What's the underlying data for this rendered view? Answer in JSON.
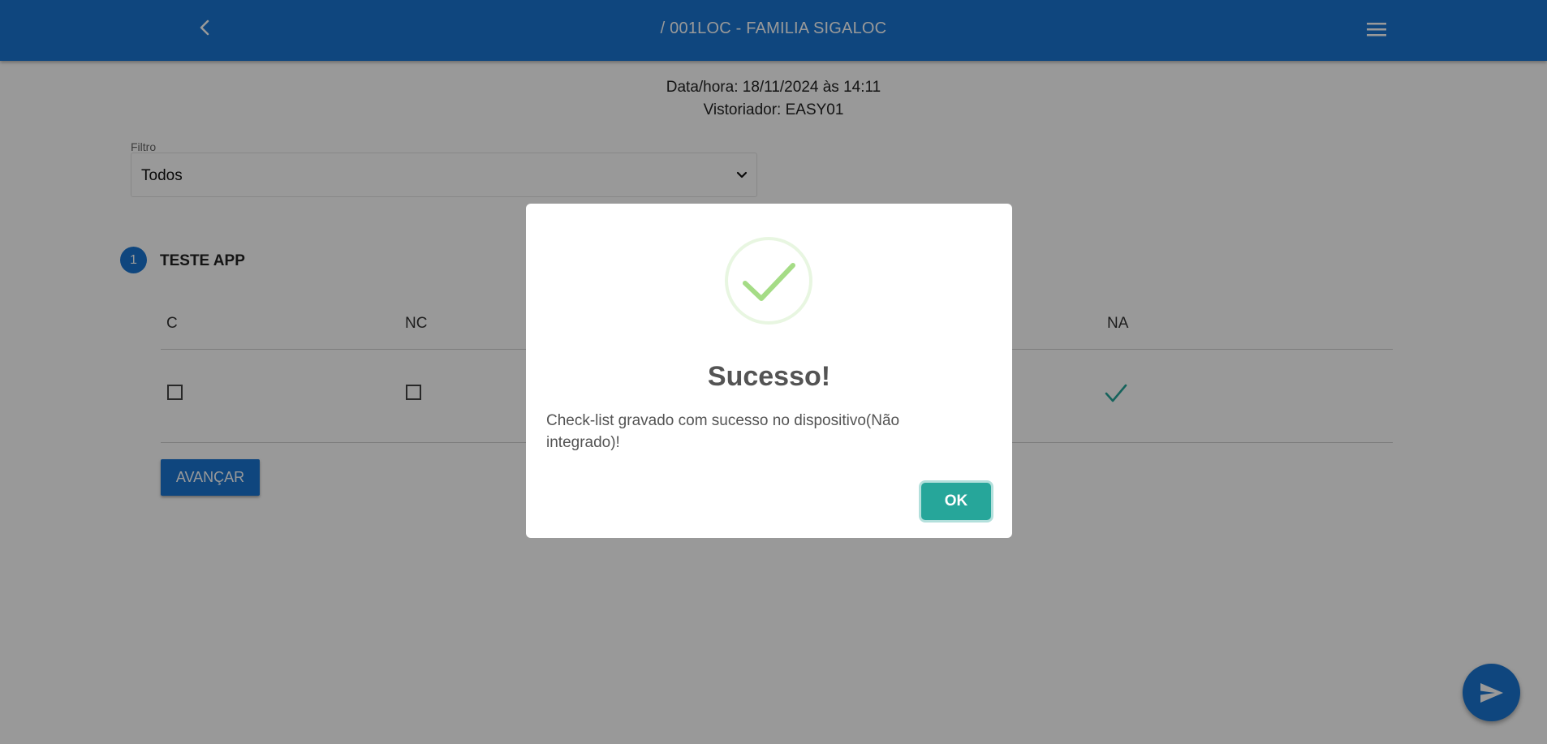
{
  "header": {
    "title": "/ 001LOC - FAMILIA SIGALOC",
    "back_icon": "chevron-left-icon",
    "menu_icon": "hamburger-menu-icon"
  },
  "info": {
    "datetime": "Data/hora: 18/11/2024 às 14:11",
    "inspector": "Vistoriador: EASY01"
  },
  "filter": {
    "label": "Filtro",
    "selected": "Todos"
  },
  "section": {
    "number": "1",
    "title": "TESTE APP",
    "columns": [
      "C",
      "NC",
      "NA"
    ],
    "selected_option": "NA"
  },
  "actions": {
    "advance_label": "AVANÇAR",
    "send_icon": "send-icon"
  },
  "dialog": {
    "icon": "success-check-icon",
    "title": "Sucesso!",
    "message": "Check-list gravado com sucesso no dispositivo(Não integrado)!",
    "ok_label": "OK"
  },
  "colors": {
    "primary": "#1976d2",
    "ok_button": "#26a69a",
    "success": "#a5dc86",
    "overlay": "rgba(0,0,0,0.4)"
  }
}
